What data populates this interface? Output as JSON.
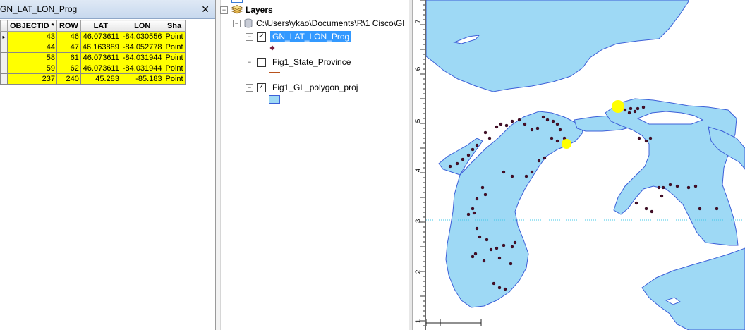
{
  "table": {
    "title": "GN_LAT_LON_Prog",
    "close_glyph": "✕",
    "columns": [
      "",
      "OBJECTID *",
      "ROW",
      "LAT",
      "LON",
      "Sha"
    ],
    "rows": [
      {
        "objectid": "43",
        "row": "46",
        "lat": "46.073611",
        "lon": "-84.030556",
        "shape": "Point",
        "selected": true
      },
      {
        "objectid": "44",
        "row": "47",
        "lat": "46.163889",
        "lon": "-84.052778",
        "shape": "Point"
      },
      {
        "objectid": "58",
        "row": "61",
        "lat": "46.073611",
        "lon": "-84.031944",
        "shape": "Point"
      },
      {
        "objectid": "59",
        "row": "62",
        "lat": "46.073611",
        "lon": "-84.031944",
        "shape": "Point"
      },
      {
        "objectid": "237",
        "row": "240",
        "lat": "45.283",
        "lon": "-85.183",
        "shape": "Point"
      }
    ],
    "highlight_color": "#ffff00"
  },
  "toc": {
    "root_label": "Layers",
    "source_path": "C:\\Users\\ykao\\Documents\\R\\1 Cisco\\Gl",
    "layers": [
      {
        "name": "GN_LAT_LON_Prog",
        "checked": true,
        "selected": true,
        "symbol": "point"
      },
      {
        "name": "Fig1_State_Province",
        "checked": false,
        "selected": false,
        "symbol": "line"
      },
      {
        "name": "Fig1_GL_polygon_proj",
        "checked": true,
        "selected": false,
        "symbol": "polygon"
      }
    ],
    "collapse_glyph": "−",
    "check_glyph": "✓"
  },
  "map": {
    "ruler_labels": [
      "7",
      "6",
      "5",
      "4",
      "3",
      "2",
      "1"
    ],
    "water_color": "#9ed9f5",
    "shore_color": "#3c5fd8",
    "highlight_point_color": "#ffff00",
    "point_color": "#4a0e2a"
  }
}
